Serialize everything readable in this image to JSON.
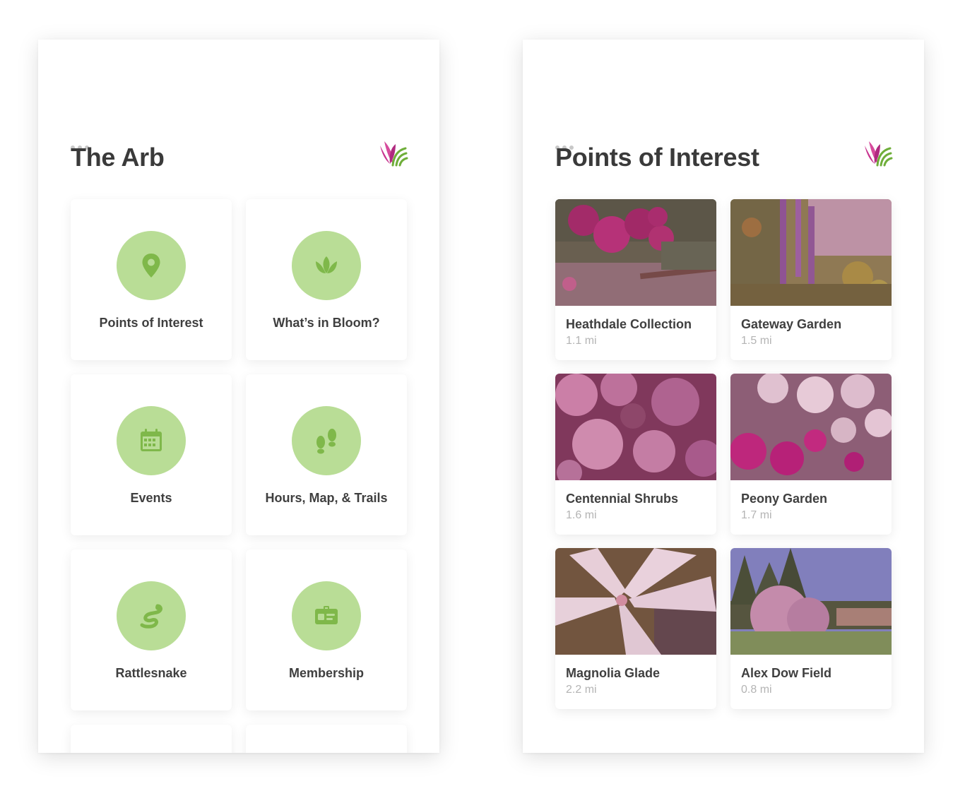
{
  "home": {
    "title": "The Arb",
    "tiles": [
      {
        "label": "Points of Interest",
        "icon": "map-pin-icon"
      },
      {
        "label": "What’s in Bloom?",
        "icon": "lotus-icon"
      },
      {
        "label": "Events",
        "icon": "calendar-icon"
      },
      {
        "label": "Hours, Map, & Trails",
        "icon": "footprints-icon"
      },
      {
        "label": "Rattlesnake",
        "icon": "snake-icon"
      },
      {
        "label": "Membership",
        "icon": "member-card-icon"
      }
    ]
  },
  "poi": {
    "title": "Points of Interest",
    "places": [
      {
        "name": "Heathdale Collection",
        "distance": "1.1 mi"
      },
      {
        "name": "Gateway Garden",
        "distance": "1.5 mi"
      },
      {
        "name": "Centennial Shrubs",
        "distance": "1.6 mi"
      },
      {
        "name": "Peony Garden",
        "distance": "1.7 mi"
      },
      {
        "name": "Magnolia Glade",
        "distance": "2.2 mi"
      },
      {
        "name": "Alex Dow Field",
        "distance": "0.8 mi"
      }
    ]
  },
  "colors": {
    "accent_green": "#b9dd96",
    "icon_green": "#7fb84a",
    "logo_magenta": "#c8338f",
    "logo_green": "#6fae3a",
    "title_text": "#3a3a3a",
    "muted_text": "#b4b4b4"
  }
}
